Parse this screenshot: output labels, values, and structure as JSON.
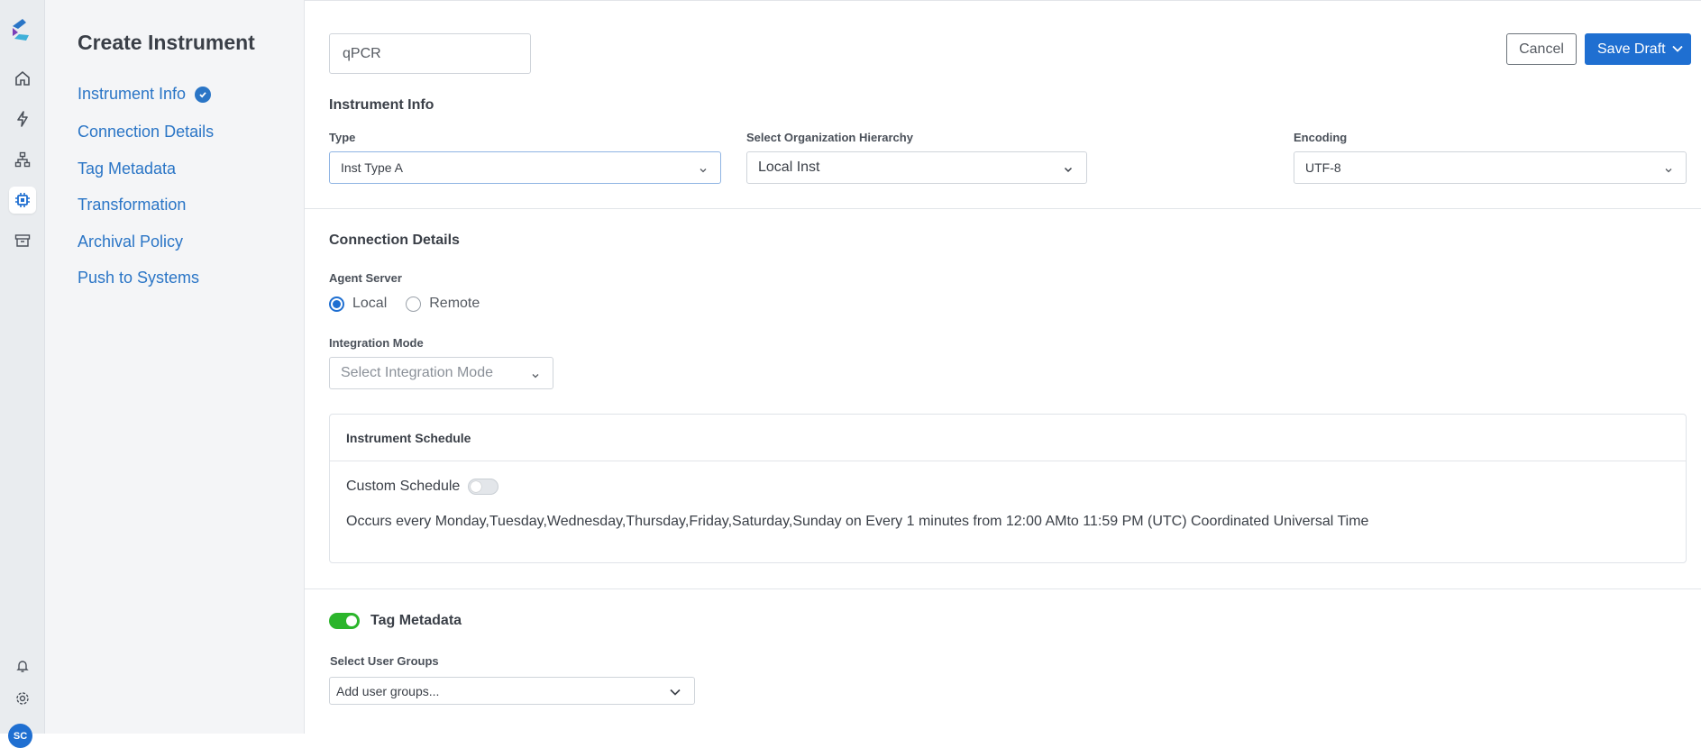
{
  "rail": {
    "avatar_initials": "SC",
    "nav_icons": [
      "home-icon",
      "lightning-icon",
      "hierarchy-icon",
      "chip-icon",
      "archive-icon"
    ],
    "bottom_icons": [
      "bell-icon",
      "gear-icon"
    ],
    "active_index": 3,
    "accent": "#1f6fd1"
  },
  "sidebar": {
    "title": "Create Instrument",
    "steps": [
      {
        "label": "Instrument Info",
        "completed": true
      },
      {
        "label": "Connection Details",
        "completed": false
      },
      {
        "label": "Tag Metadata",
        "completed": false
      },
      {
        "label": "Transformation",
        "completed": false
      },
      {
        "label": "Archival Policy",
        "completed": false
      },
      {
        "label": "Push to Systems",
        "completed": false
      }
    ]
  },
  "header": {
    "name_value": "qPCR",
    "cancel_label": "Cancel",
    "save_label": "Save Draft"
  },
  "instrument_info": {
    "title": "Instrument Info",
    "type_label": "Type",
    "type_value": "Inst Type A",
    "org_label": "Select Organization Hierarchy",
    "org_value": "Local Inst",
    "encoding_label": "Encoding",
    "encoding_value": "UTF-8"
  },
  "connection": {
    "title": "Connection Details",
    "agent_label": "Agent Server",
    "agent_options": [
      "Local",
      "Remote"
    ],
    "agent_selected": "Local",
    "mode_label": "Integration Mode",
    "mode_placeholder": "Select Integration Mode"
  },
  "schedule": {
    "title": "Instrument Schedule",
    "custom_label": "Custom Schedule",
    "custom_enabled": false,
    "description": "Occurs every Monday,Tuesday,Wednesday,Thursday,Friday,Saturday,Sunday on Every 1 minutes from 12:00 AMto 11:59 PM (UTC) Coordinated Universal Time"
  },
  "tag_metadata": {
    "title": "Tag Metadata",
    "enabled": true,
    "groups_label": "Select User Groups",
    "groups_placeholder": "Add user groups..."
  }
}
